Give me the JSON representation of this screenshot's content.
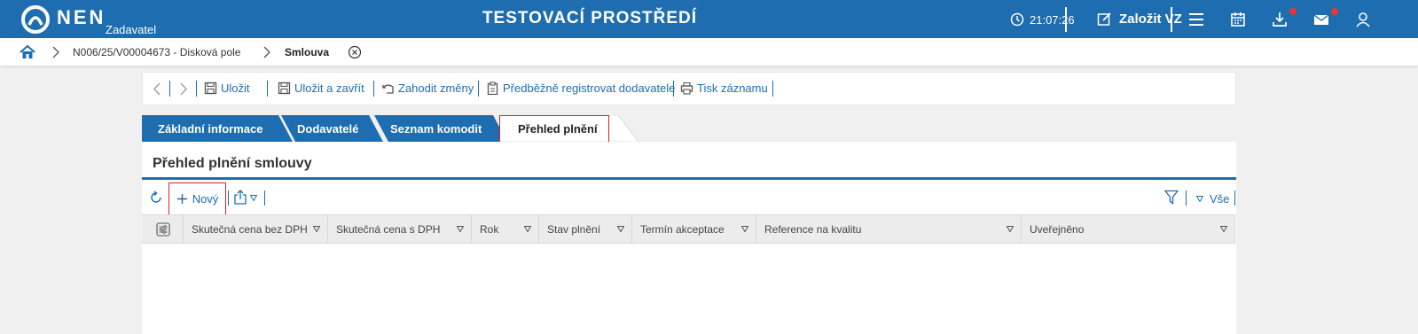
{
  "topbar": {
    "brand": "NEN",
    "role": "Zadavatel",
    "environment": "TESTOVACÍ PROSTŘEDÍ",
    "clock": "21:07:26",
    "create_label": "Založit VZ",
    "bg_color": "#1d6db0",
    "icons": [
      "clock-icon",
      "edit-icon",
      "menu-icon",
      "calendar-icon",
      "download-icon",
      "mail-icon",
      "user-icon"
    ]
  },
  "breadcrumb": {
    "items": [
      "N006/25/V00004673 - Disková pole",
      "Smlouva"
    ]
  },
  "toolbar": {
    "save": "Uložit",
    "save_close": "Uložit a zavřít",
    "discard": "Zahodit změny",
    "preregister": "Předběžně registrovat dodavatele",
    "print": "Tisk záznamu"
  },
  "tabs": [
    {
      "label": "Základní informace",
      "active": false
    },
    {
      "label": "Dodavatelé",
      "active": false
    },
    {
      "label": "Seznam komodit",
      "active": false
    },
    {
      "label": "Přehled plnění",
      "active": true
    }
  ],
  "panel": {
    "title": "Přehled plnění smlouvy",
    "new_label": "Nový",
    "all_label": "Vše"
  },
  "table": {
    "columns": [
      "Skutečná cena bez DPH",
      "Skutečná cena s DPH",
      "Rok",
      "Stav plnění",
      "Termín akceptace",
      "Reference na kvalitu",
      "Uveřejněno"
    ],
    "rows": []
  },
  "colors": {
    "accent": "#1d6db0",
    "highlight": "#e02020",
    "notification": "#e53935"
  }
}
